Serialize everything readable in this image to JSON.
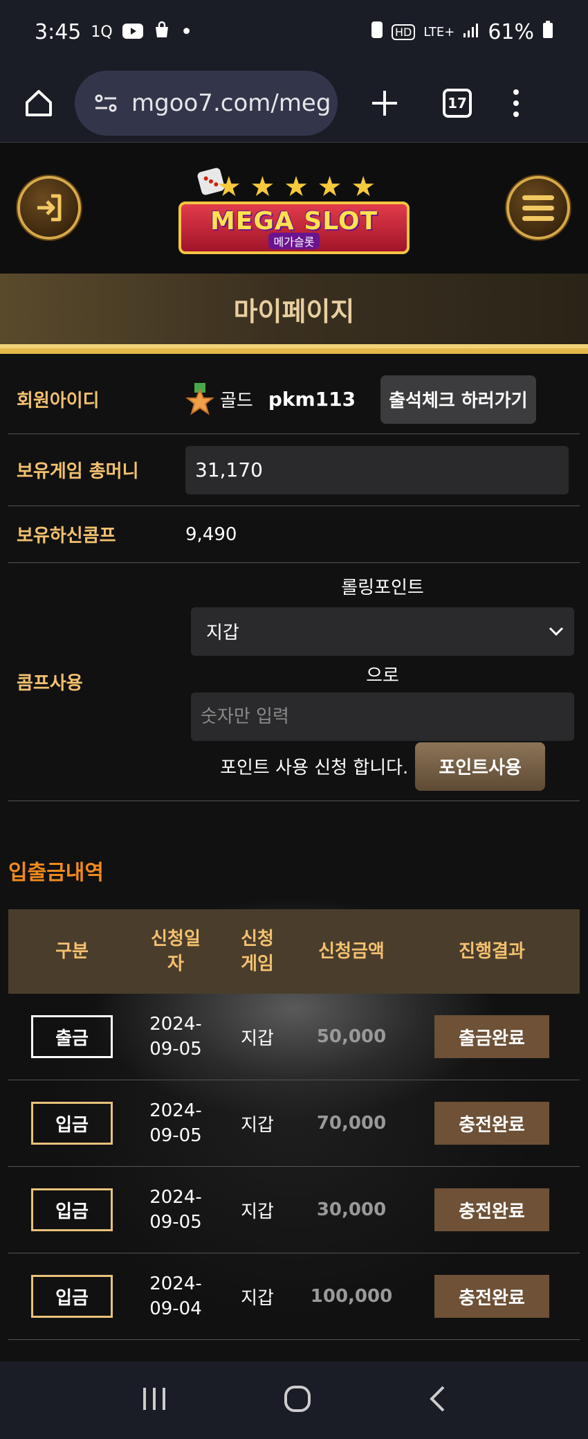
{
  "status_bar": {
    "time": "3:45",
    "left_icons": [
      "1q-icon",
      "youtube-icon",
      "shopping-bag-icon",
      "dot-icon"
    ],
    "right_icons": [
      "battery-saver-icon",
      "hd-icon",
      "lte-icon",
      "signal-icon"
    ],
    "network": "LTE+",
    "battery": "61%"
  },
  "browser": {
    "url": "mgoo7.com/meg",
    "tab_count": "17"
  },
  "site": {
    "logo_text": "MEGA SLOT",
    "logo_sub": "메가슬롯",
    "page_title": "마이페이지"
  },
  "account": {
    "id_label": "회원아이디",
    "grade": "골드",
    "user_id": "pkm113",
    "attend_button": "출석체크 하러가기",
    "money_label": "보유게임 총머니",
    "money_value": "31,170",
    "comp_label": "보유하신콤프",
    "comp_value": "9,490",
    "use_label": "콤프사용",
    "rolling_label": "롤링포인트",
    "wallet_selected": "지갑",
    "to_label": "으로",
    "amount_placeholder": "숫자만 입력",
    "apply_text": "포인트 사용 신청 합니다.",
    "point_button": "포인트사용"
  },
  "history": {
    "title": "입출금내역",
    "headers": {
      "type": "구분",
      "date_line1": "신청일",
      "date_line2": "자",
      "game_line1": "신청",
      "game_line2": "게임",
      "amount": "신청금액",
      "result": "진행결과"
    },
    "rows": [
      {
        "type": "출금",
        "date_line1": "2024-",
        "date_line2": "09-05",
        "game": "지갑",
        "amount": "50,000",
        "result": "출금완료"
      },
      {
        "type": "입금",
        "date_line1": "2024-",
        "date_line2": "09-05",
        "game": "지갑",
        "amount": "70,000",
        "result": "충전완료"
      },
      {
        "type": "입금",
        "date_line1": "2024-",
        "date_line2": "09-05",
        "game": "지갑",
        "amount": "30,000",
        "result": "충전완료"
      },
      {
        "type": "입금",
        "date_line1": "2024-",
        "date_line2": "09-04",
        "game": "지갑",
        "amount": "100,000",
        "result": "충전완료"
      }
    ]
  },
  "colors": {
    "accent_gold": "#f3c16f",
    "history_title": "#f08a1e",
    "result_button": "#6e5136"
  }
}
